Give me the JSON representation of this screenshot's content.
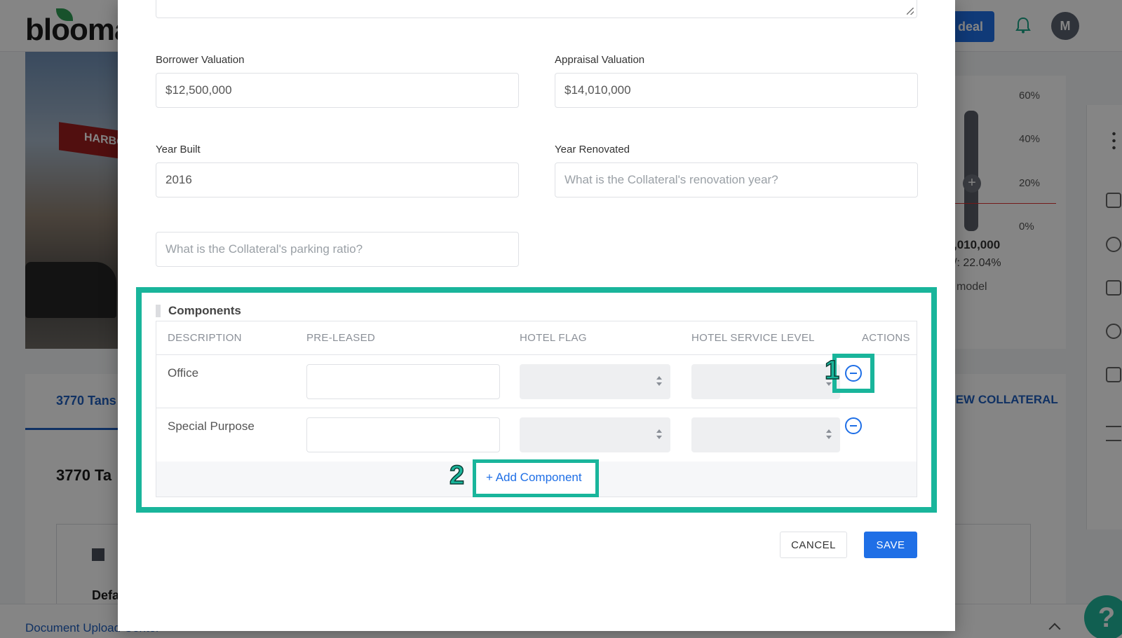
{
  "app": {
    "logo": "blooma",
    "new_deal_label": "deal",
    "avatar_initial": "M",
    "chart": {
      "ticks": [
        "60%",
        "40%",
        "20%",
        "0%"
      ],
      "value": ",010,000",
      "ltv": "/: 22.04%",
      "model": "model"
    },
    "tab_active": "3770 Tans",
    "view_collateral": "IEW COLLATERAL",
    "content_title": "3770 Ta",
    "default_label": "Defa",
    "doc_upload": "Document Upload Center",
    "help_glyph": "?"
  },
  "form": {
    "borrower_valuation": {
      "label": "Borrower Valuation",
      "value": "$12,500,000"
    },
    "appraisal_valuation": {
      "label": "Appraisal Valuation",
      "value": "$14,010,000"
    },
    "year_built": {
      "label": "Year Built",
      "value": "2016"
    },
    "year_renovated": {
      "label": "Year Renovated",
      "placeholder": "What is the Collateral's renovation year?"
    },
    "parking_ratio": {
      "placeholder": "What is the Collateral's parking ratio?"
    }
  },
  "components": {
    "title": "Components",
    "columns": [
      "DESCRIPTION",
      "PRE-LEASED",
      "HOTEL FLAG",
      "HOTEL SERVICE LEVEL",
      "ACTIONS"
    ],
    "rows": [
      {
        "description": "Office"
      },
      {
        "description": "Special Purpose"
      }
    ],
    "add_label": "+ Add Component"
  },
  "annotations": {
    "one": "1",
    "two": "2"
  },
  "footer": {
    "cancel": "CANCEL",
    "save": "SAVE"
  },
  "colors": {
    "accent": "#1f6fe6",
    "highlight": "#19b59b"
  }
}
